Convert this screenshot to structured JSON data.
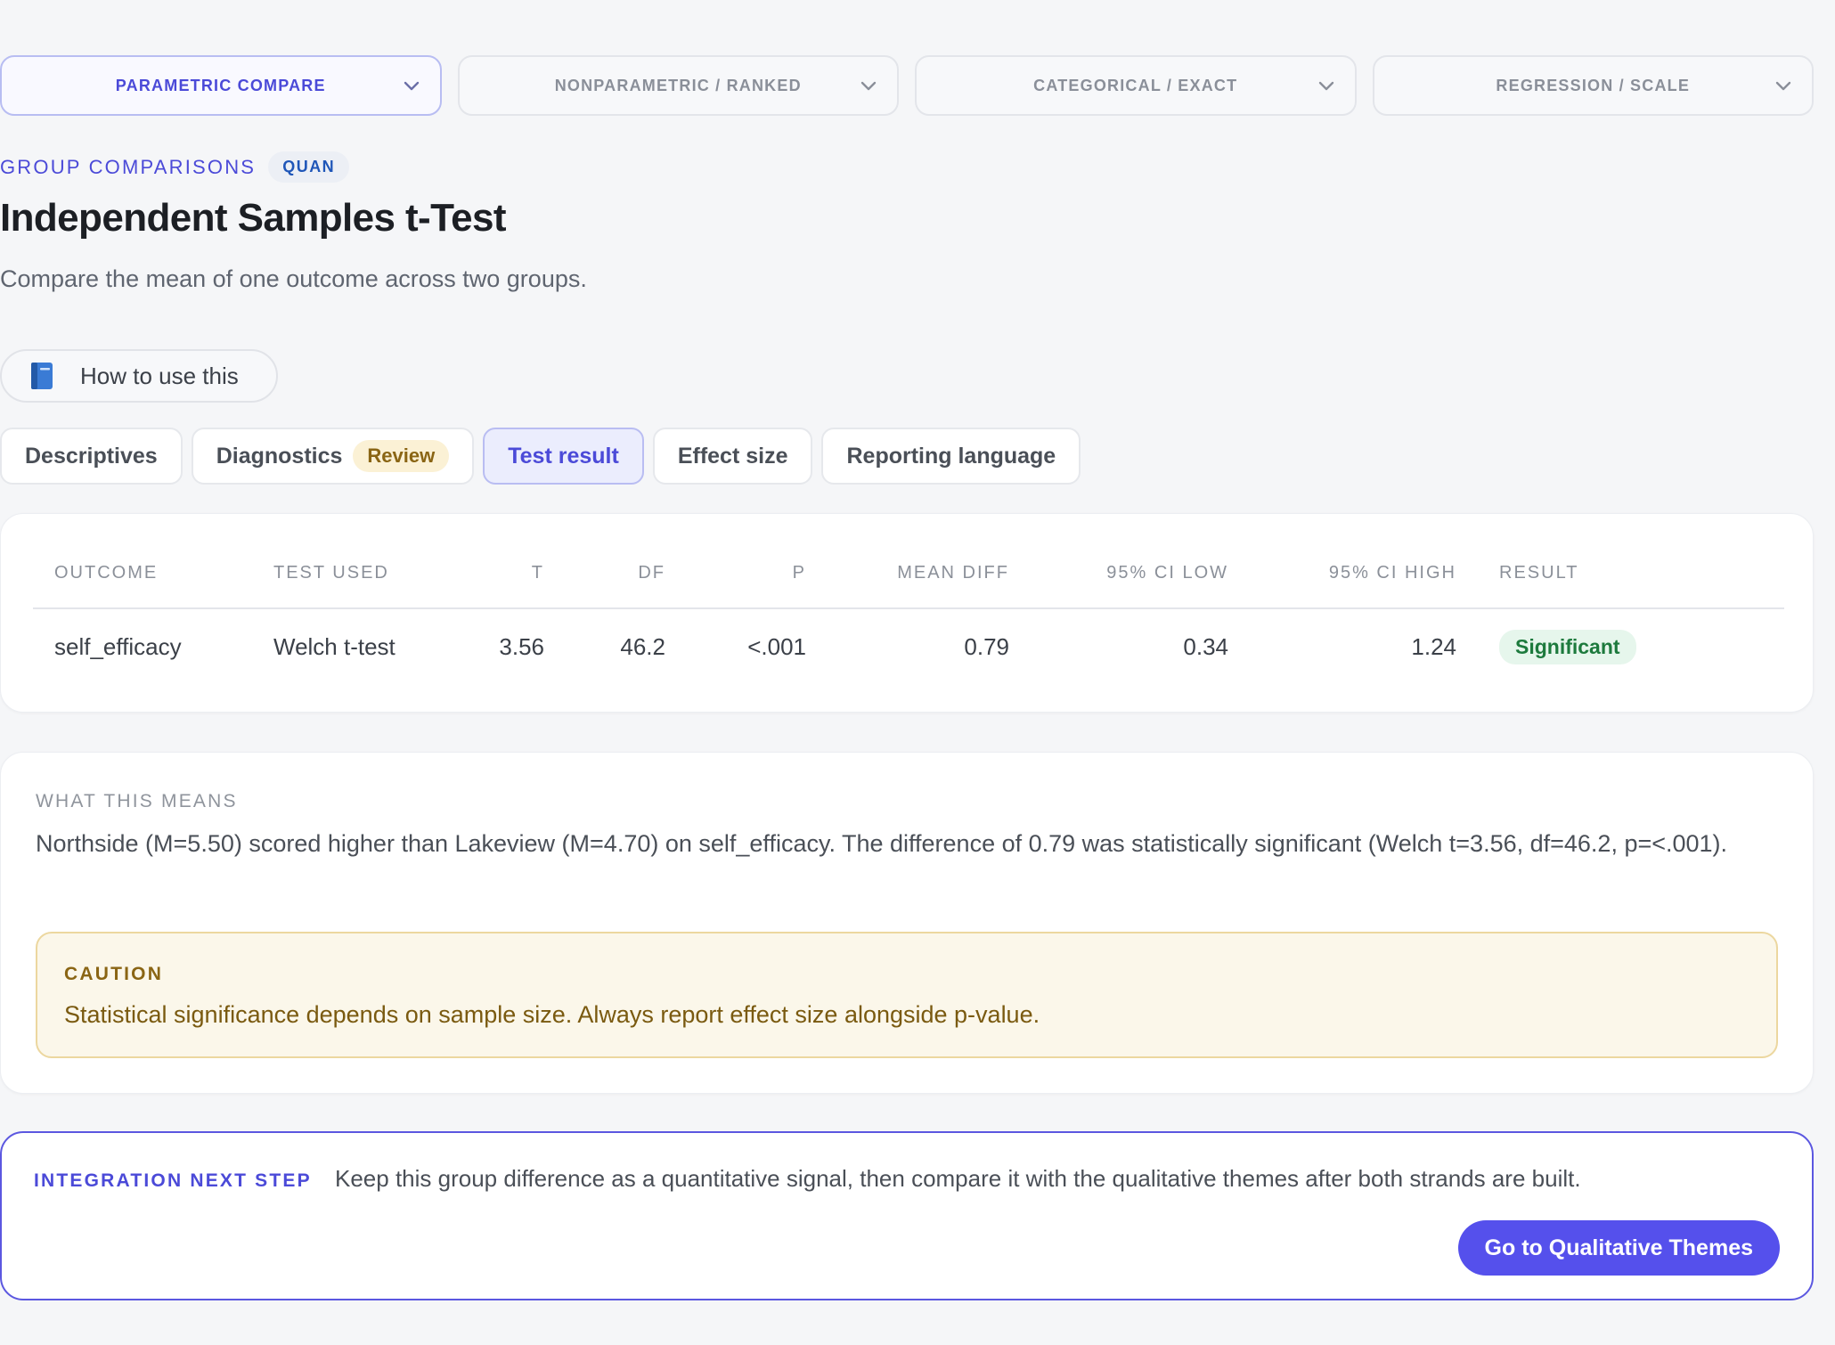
{
  "categories": [
    {
      "label": "PARAMETRIC COMPARE",
      "active": true
    },
    {
      "label": "NONPARAMETRIC / RANKED",
      "active": false
    },
    {
      "label": "CATEGORICAL / EXACT",
      "active": false
    },
    {
      "label": "REGRESSION / SCALE",
      "active": false
    }
  ],
  "header": {
    "eyebrow": "GROUP COMPARISONS",
    "badge": "QUAN",
    "title": "Independent Samples t-Test",
    "subtitle": "Compare the mean of one outcome across two groups."
  },
  "howto": {
    "label": "How to use this",
    "icon": "book-icon"
  },
  "tabs": [
    {
      "label": "Descriptives",
      "badge": ""
    },
    {
      "label": "Diagnostics",
      "badge": "Review"
    },
    {
      "label": "Test result",
      "badge": "",
      "active": true
    },
    {
      "label": "Effect size",
      "badge": ""
    },
    {
      "label": "Reporting language",
      "badge": ""
    }
  ],
  "results": {
    "columns": [
      "OUTCOME",
      "TEST USED",
      "T",
      "DF",
      "P",
      "MEAN DIFF",
      "95% CI LOW",
      "95% CI HIGH",
      "RESULT"
    ],
    "rows": [
      {
        "outcome": "self_efficacy",
        "test": "Welch t-test",
        "t": "3.56",
        "df": "46.2",
        "p": "<.001",
        "mean_diff": "0.79",
        "ci_low": "0.34",
        "ci_high": "1.24",
        "result": "Significant"
      }
    ]
  },
  "meaning": {
    "label": "WHAT THIS MEANS",
    "text": "Northside (M=5.50) scored higher than Lakeview (M=4.70) on self_efficacy. The difference of 0.79 was statistically significant (Welch t=3.56, df=46.2, p=<.001).",
    "caution_label": "CAUTION",
    "caution_text": "Statistical significance depends on sample size. Always report effect size alongside p-value."
  },
  "integration": {
    "label": "INTEGRATION NEXT STEP",
    "text": "Keep this group difference as a quantitative signal, then compare it with the qualitative themes after both strands are built.",
    "button": "Go to Qualitative Themes"
  },
  "colors": {
    "accent": "#4b4ad8",
    "button": "#5550ec",
    "significant": "#1d7a3d",
    "caution": "#8a6514"
  }
}
